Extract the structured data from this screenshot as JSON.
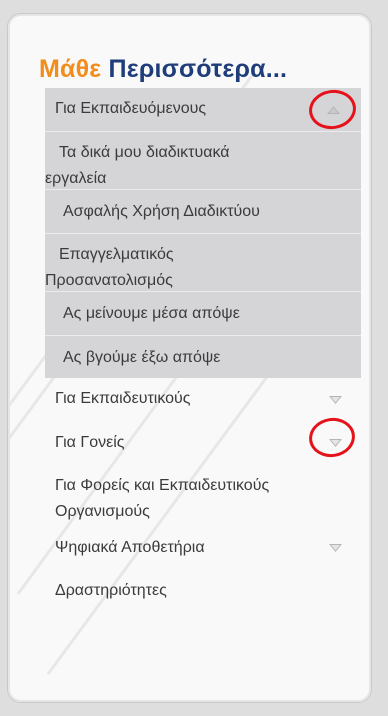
{
  "title": {
    "word1": "Μάθε",
    "word2": "Περισσότερα..."
  },
  "menu": [
    {
      "label": "Για Εκπαιδευόμενους",
      "arrow": "up-arrow-icon",
      "expanded": true
    },
    {
      "label": "Τα δικά μου διαδικτυακά εργαλεία",
      "sub": true
    },
    {
      "label": "Ασφαλής Χρήση Διαδικτύου",
      "sub": true
    },
    {
      "label": "Επαγγελματικός Προσανατολισμός",
      "sub": true
    },
    {
      "label": "Ας μείνουμε μέσα απόψε",
      "sub": true
    },
    {
      "label": "Ας βγούμε έξω απόψε",
      "sub": true
    },
    {
      "label": "Για Εκπαιδευτικούς",
      "arrow": "down-arrow-icon"
    },
    {
      "label": "Για Γονείς",
      "arrow": "down-arrow-icon"
    },
    {
      "label": "Για Φορείς και Εκπαιδευτικούς Οργανισμούς"
    },
    {
      "label": "Ψηφιακά Αποθετήρια",
      "arrow": "down-arrow-icon"
    },
    {
      "label": "Δραστηριότητες"
    }
  ],
  "colors": {
    "orange": "#f28c1b",
    "navy": "#1e3d7a",
    "highlight_red": "#e5121b"
  }
}
